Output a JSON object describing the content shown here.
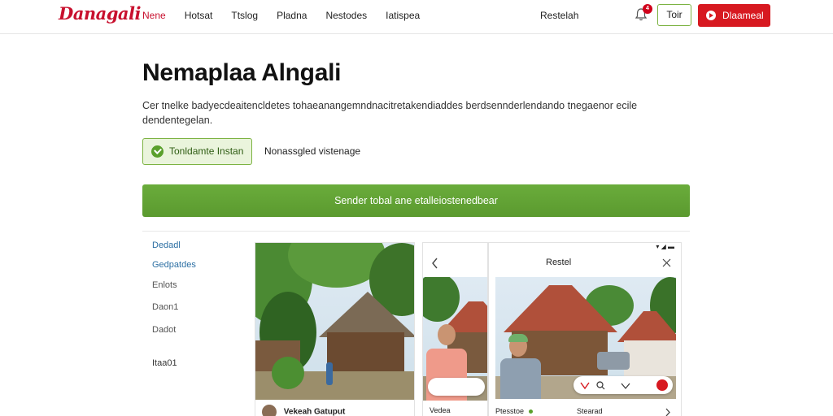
{
  "header": {
    "logo": "Danagali",
    "nav": [
      {
        "label": "Nene",
        "active": true
      },
      {
        "label": "Hotsat",
        "active": false
      },
      {
        "label": "Ttslog",
        "active": false
      },
      {
        "label": "Pladna",
        "active": false
      },
      {
        "label": "Nestodes",
        "active": false
      },
      {
        "label": "Iatispea",
        "active": false
      }
    ],
    "right_link": "Restelah",
    "notification_count": "4",
    "outline_button": "Toir",
    "primary_button": "Dlaameal"
  },
  "hero": {
    "title": "Nemaplaa Alngali",
    "description": "Cer tnelke badyecdeaitencldetes tohaeanangemndnacitretakendiaddes berdsennderlendando tnegaenor ecile dendentegelan.",
    "badge_label": "Tonldamte Instan",
    "badge_side_text": "Nonassgled vistenage",
    "cta_label": "Sender tobal ane etalleiostenedbear"
  },
  "sidebar": {
    "items": [
      "Dedadl",
      "Gedpatdes",
      "Enlots",
      "Daon1",
      "Dadot",
      "Itaa01"
    ],
    "colors": [
      "#2c6fa3",
      "#2c6fa3",
      "#555555",
      "#555555",
      "#555555",
      "#333333"
    ]
  },
  "cards": {
    "card1": {
      "author": "Vekeah Gatuput"
    },
    "card2": {
      "caption": "Vedea"
    },
    "card3": {
      "title": "Restel",
      "bottom_left": "Ptesstoe",
      "bottom_right": "Stearad"
    }
  },
  "colors": {
    "brand_red": "#c8102e",
    "primary_button": "#d71920",
    "cta_green": "#5b9a2f",
    "badge_green": "#eaf4dc"
  },
  "icons": [
    "bell-icon",
    "play-icon",
    "check-icon",
    "back-chevron-icon",
    "close-icon",
    "heart-icon",
    "search-icon",
    "share-icon",
    "like-icon"
  ]
}
